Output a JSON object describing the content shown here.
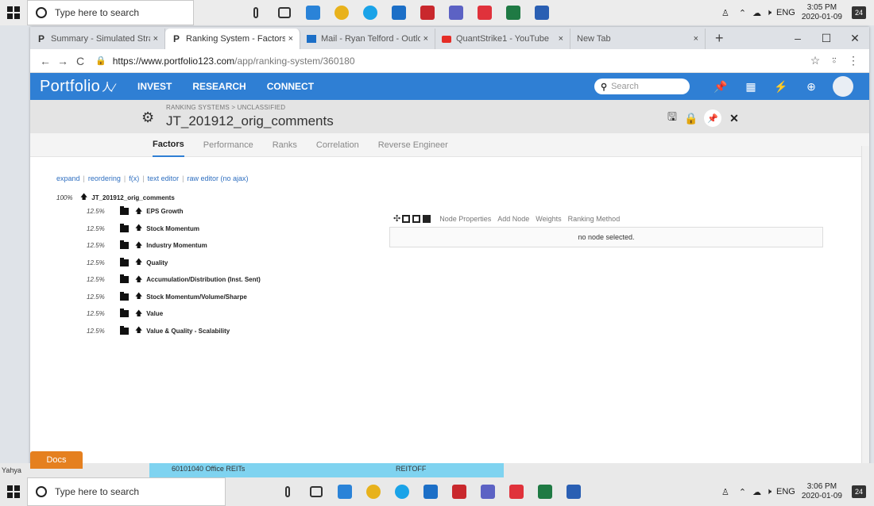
{
  "taskbar_top": {
    "search_placeholder": "Type here to search",
    "tray_lang": "ENG",
    "time": "3:05 PM",
    "date": "2020-01-09",
    "notif_count": "24"
  },
  "taskbar_bottom": {
    "search_placeholder": "Type here to search",
    "tray_lang": "ENG",
    "time": "3:06 PM",
    "date": "2020-01-09",
    "notif_count": "24"
  },
  "browser": {
    "tabs": [
      {
        "favicon": "P",
        "title": "Summary - Simulated Stra",
        "close": "×"
      },
      {
        "favicon": "P",
        "title": "Ranking System - Factors",
        "close": "×"
      },
      {
        "favicon": "outlook",
        "title": "Mail - Ryan Telford - Outlo",
        "close": "×"
      },
      {
        "favicon": "youtube",
        "title": "QuantStrike1 - YouTube",
        "close": "×"
      },
      {
        "favicon": "",
        "title": "New Tab",
        "close": "×"
      }
    ],
    "url_host": "https://www.portfolio123.com",
    "url_path": "/app/ranking-system/360180"
  },
  "site": {
    "logo": "Portfolio",
    "nav": [
      "INVEST",
      "RESEARCH",
      "CONNECT"
    ],
    "search_placeholder": "Search"
  },
  "page": {
    "breadcrumb": "RANKING SYSTEMS > UNCLASSIFIED",
    "title": "JT_201912_orig_comments"
  },
  "subtabs": [
    "Factors",
    "Performance",
    "Ranks",
    "Correlation",
    "Reverse Engineer"
  ],
  "links": [
    "expand",
    "reordering",
    "f(x)",
    "text editor",
    "raw editor (no ajax)"
  ],
  "tree": {
    "root": {
      "pct": "100%",
      "name": "JT_201912_orig_comments"
    },
    "nodes": [
      {
        "pct": "12.5%",
        "name": "EPS Growth"
      },
      {
        "pct": "12.5%",
        "name": "Stock Momentum"
      },
      {
        "pct": "12.5%",
        "name": "Industry Momentum"
      },
      {
        "pct": "12.5%",
        "name": "Quality"
      },
      {
        "pct": "12.5%",
        "name": "Accumulation/Distribution (Inst. Sent)"
      },
      {
        "pct": "12.5%",
        "name": "Stock Momentum/Volume/Sharpe"
      },
      {
        "pct": "12.5%",
        "name": "Value"
      },
      {
        "pct": "12.5%",
        "name": "Value & Quality - Scalability"
      }
    ]
  },
  "node_toolbar": [
    "Node Properties",
    "Add Node",
    "Weights",
    "Ranking Method"
  ],
  "no_node": "no node selected.",
  "docs": "Docs",
  "background": {
    "user": "Yahya",
    "row_left": "60101040 Office REITs",
    "row_right": "REITOFF"
  },
  "colors": {
    "brand_blue": "#2f7fd4",
    "docs_orange": "#e5801f"
  }
}
